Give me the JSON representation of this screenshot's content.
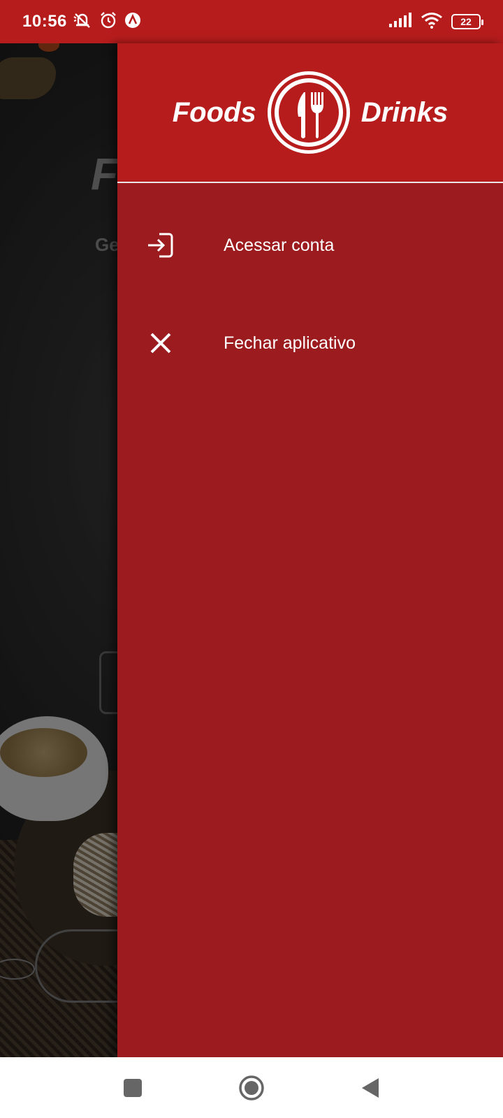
{
  "status_bar": {
    "time": "10:56",
    "left_icons": [
      "mute-icon",
      "alarm-icon",
      "app-notification-icon"
    ],
    "right_icons": [
      "signal-icon",
      "wifi-icon",
      "battery-icon"
    ],
    "battery_level": "22"
  },
  "drawer": {
    "logo": {
      "left_word": "Foods",
      "right_word": "Drinks",
      "icon": "fork-knife-icon"
    },
    "items": [
      {
        "label": "Acessar conta",
        "icon": "login-icon"
      },
      {
        "label": "Fechar aplicativo",
        "icon": "close-icon"
      }
    ]
  },
  "background": {
    "title_fragment": "F",
    "subtitle_fragment": "Ge"
  },
  "nav_bar": {
    "buttons": [
      "recents-button",
      "home-button",
      "back-button"
    ]
  },
  "colors": {
    "status_bar": "#b71c1c",
    "drawer_header": "#b71c1c",
    "drawer_body": "#9b1b1e",
    "text": "#ffffff"
  }
}
